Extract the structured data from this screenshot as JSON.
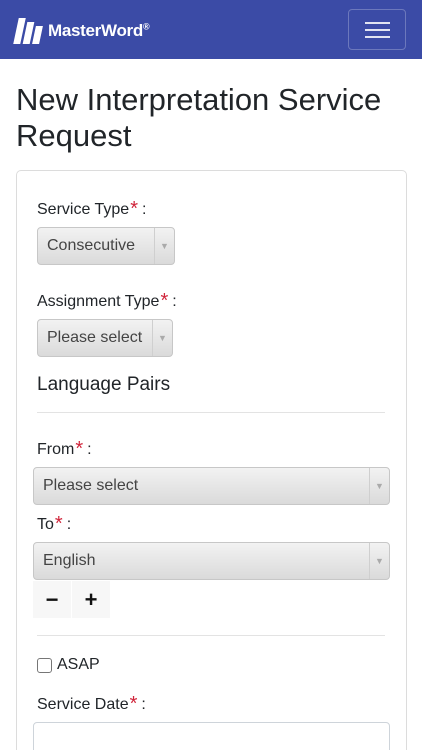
{
  "navbar": {
    "brand": "MasterWord",
    "brand_mark": "®",
    "menu_icon": "hamburger-menu-icon"
  },
  "page": {
    "title": "New Interpretation Service Request"
  },
  "form": {
    "service_type": {
      "label": "Service Type",
      "required": "*",
      "colon": ":",
      "value": "Consecutive"
    },
    "assignment_type": {
      "label": "Assignment Type",
      "required": "*",
      "colon": ":",
      "value": "Please select"
    },
    "language_pairs": {
      "heading": "Language Pairs",
      "from": {
        "label": "From",
        "required": "*",
        "colon": ":",
        "value": "Please select"
      },
      "to": {
        "label": "To",
        "required": "*",
        "colon": ":",
        "value": "English"
      },
      "remove_symbol": "−",
      "add_symbol": "+"
    },
    "asap": {
      "label": "ASAP",
      "checked": false
    },
    "service_date": {
      "label": "Service Date",
      "required": "*",
      "colon": ":",
      "value": ""
    }
  },
  "colors": {
    "navbar": "#3b4ba6",
    "required": "#d0243a"
  }
}
